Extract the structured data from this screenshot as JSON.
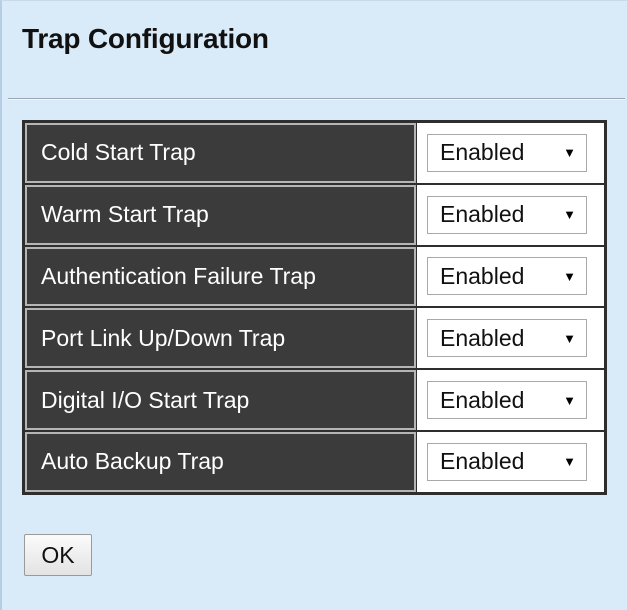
{
  "page": {
    "title": "Trap Configuration"
  },
  "traps": [
    {
      "label": "Cold Start Trap",
      "value": "Enabled"
    },
    {
      "label": "Warm Start Trap",
      "value": "Enabled"
    },
    {
      "label": "Authentication Failure Trap",
      "value": "Enabled"
    },
    {
      "label": "Port Link Up/Down Trap",
      "value": "Enabled"
    },
    {
      "label": "Digital I/O Start Trap",
      "value": "Enabled"
    },
    {
      "label": "Auto Backup Trap",
      "value": "Enabled"
    }
  ],
  "actions": {
    "ok_label": "OK"
  },
  "icons": {
    "dropdown": "chevron-down-icon"
  },
  "colors": {
    "panel_background": "#d9eaf9",
    "label_cell_background": "#3b3b3b",
    "label_text": "#ffffff",
    "table_border": "#2e2e2e"
  }
}
